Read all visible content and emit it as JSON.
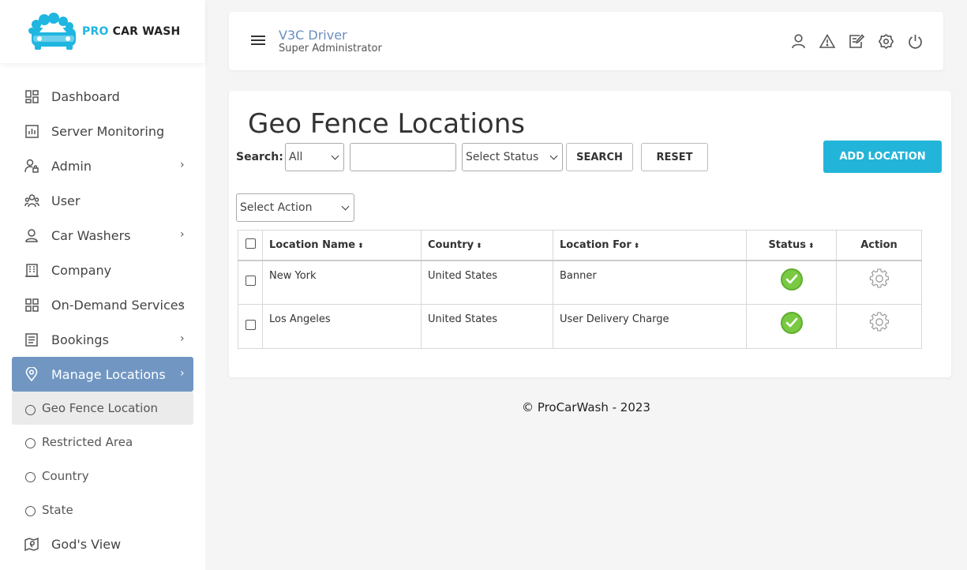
{
  "brand": {
    "pro": "PRO",
    "rest": "CAR WASH",
    "accent": "#1fb6e0"
  },
  "sidebar": {
    "items": [
      {
        "label": "Dashboard",
        "icon": "dashboard-icon"
      },
      {
        "label": "Server Monitoring",
        "icon": "chart-icon"
      },
      {
        "label": "Admin",
        "icon": "admin-icon",
        "chevron": "›"
      },
      {
        "label": "User",
        "icon": "users-icon"
      },
      {
        "label": "Car Washers",
        "icon": "person-icon",
        "chevron": "›"
      },
      {
        "label": "Company",
        "icon": "building-icon"
      },
      {
        "label": "On-Demand Services",
        "icon": "grid-icon",
        "chevron": "›"
      },
      {
        "label": "Bookings",
        "icon": "list-icon",
        "chevron": "›"
      },
      {
        "label": "Manage Locations",
        "icon": "location-pin-icon",
        "chevron": "›",
        "active": true
      }
    ],
    "subitems": [
      {
        "label": "Geo Fence Location",
        "active": true
      },
      {
        "label": "Restricted Area"
      },
      {
        "label": "Country"
      },
      {
        "label": "State"
      }
    ],
    "last_item": {
      "label": "God's View",
      "icon": "map-icon"
    }
  },
  "header": {
    "user_name": "V3C Driver",
    "user_role": "Super Administrator",
    "icons": [
      "profile-icon",
      "warning-icon",
      "edit-icon",
      "settings-icon",
      "power-icon"
    ]
  },
  "main": {
    "title": "Geo Fence Locations",
    "search_label": "Search:",
    "search_field_value": "All",
    "search_input_value": "",
    "status_select_value": "Select Status",
    "search_button": "SEARCH",
    "reset_button": "RESET",
    "add_button": "ADD LOCATION",
    "action_select_value": "Select Action",
    "columns": {
      "location_name": "Location Name",
      "country": "Country",
      "location_for": "Location For",
      "status": "Status",
      "action": "Action"
    },
    "rows": [
      {
        "location_name": "New York",
        "country": "United States",
        "location_for": "Banner",
        "status": "active"
      },
      {
        "location_name": "Los Angeles",
        "country": "United States",
        "location_for": "User Delivery Charge",
        "status": "active"
      }
    ]
  },
  "footer": {
    "text": "© ProCarWash - 2023"
  },
  "colors": {
    "active_nav": "#7196c2",
    "add_button": "#23b5d9",
    "status_ok": "#7ac943"
  }
}
